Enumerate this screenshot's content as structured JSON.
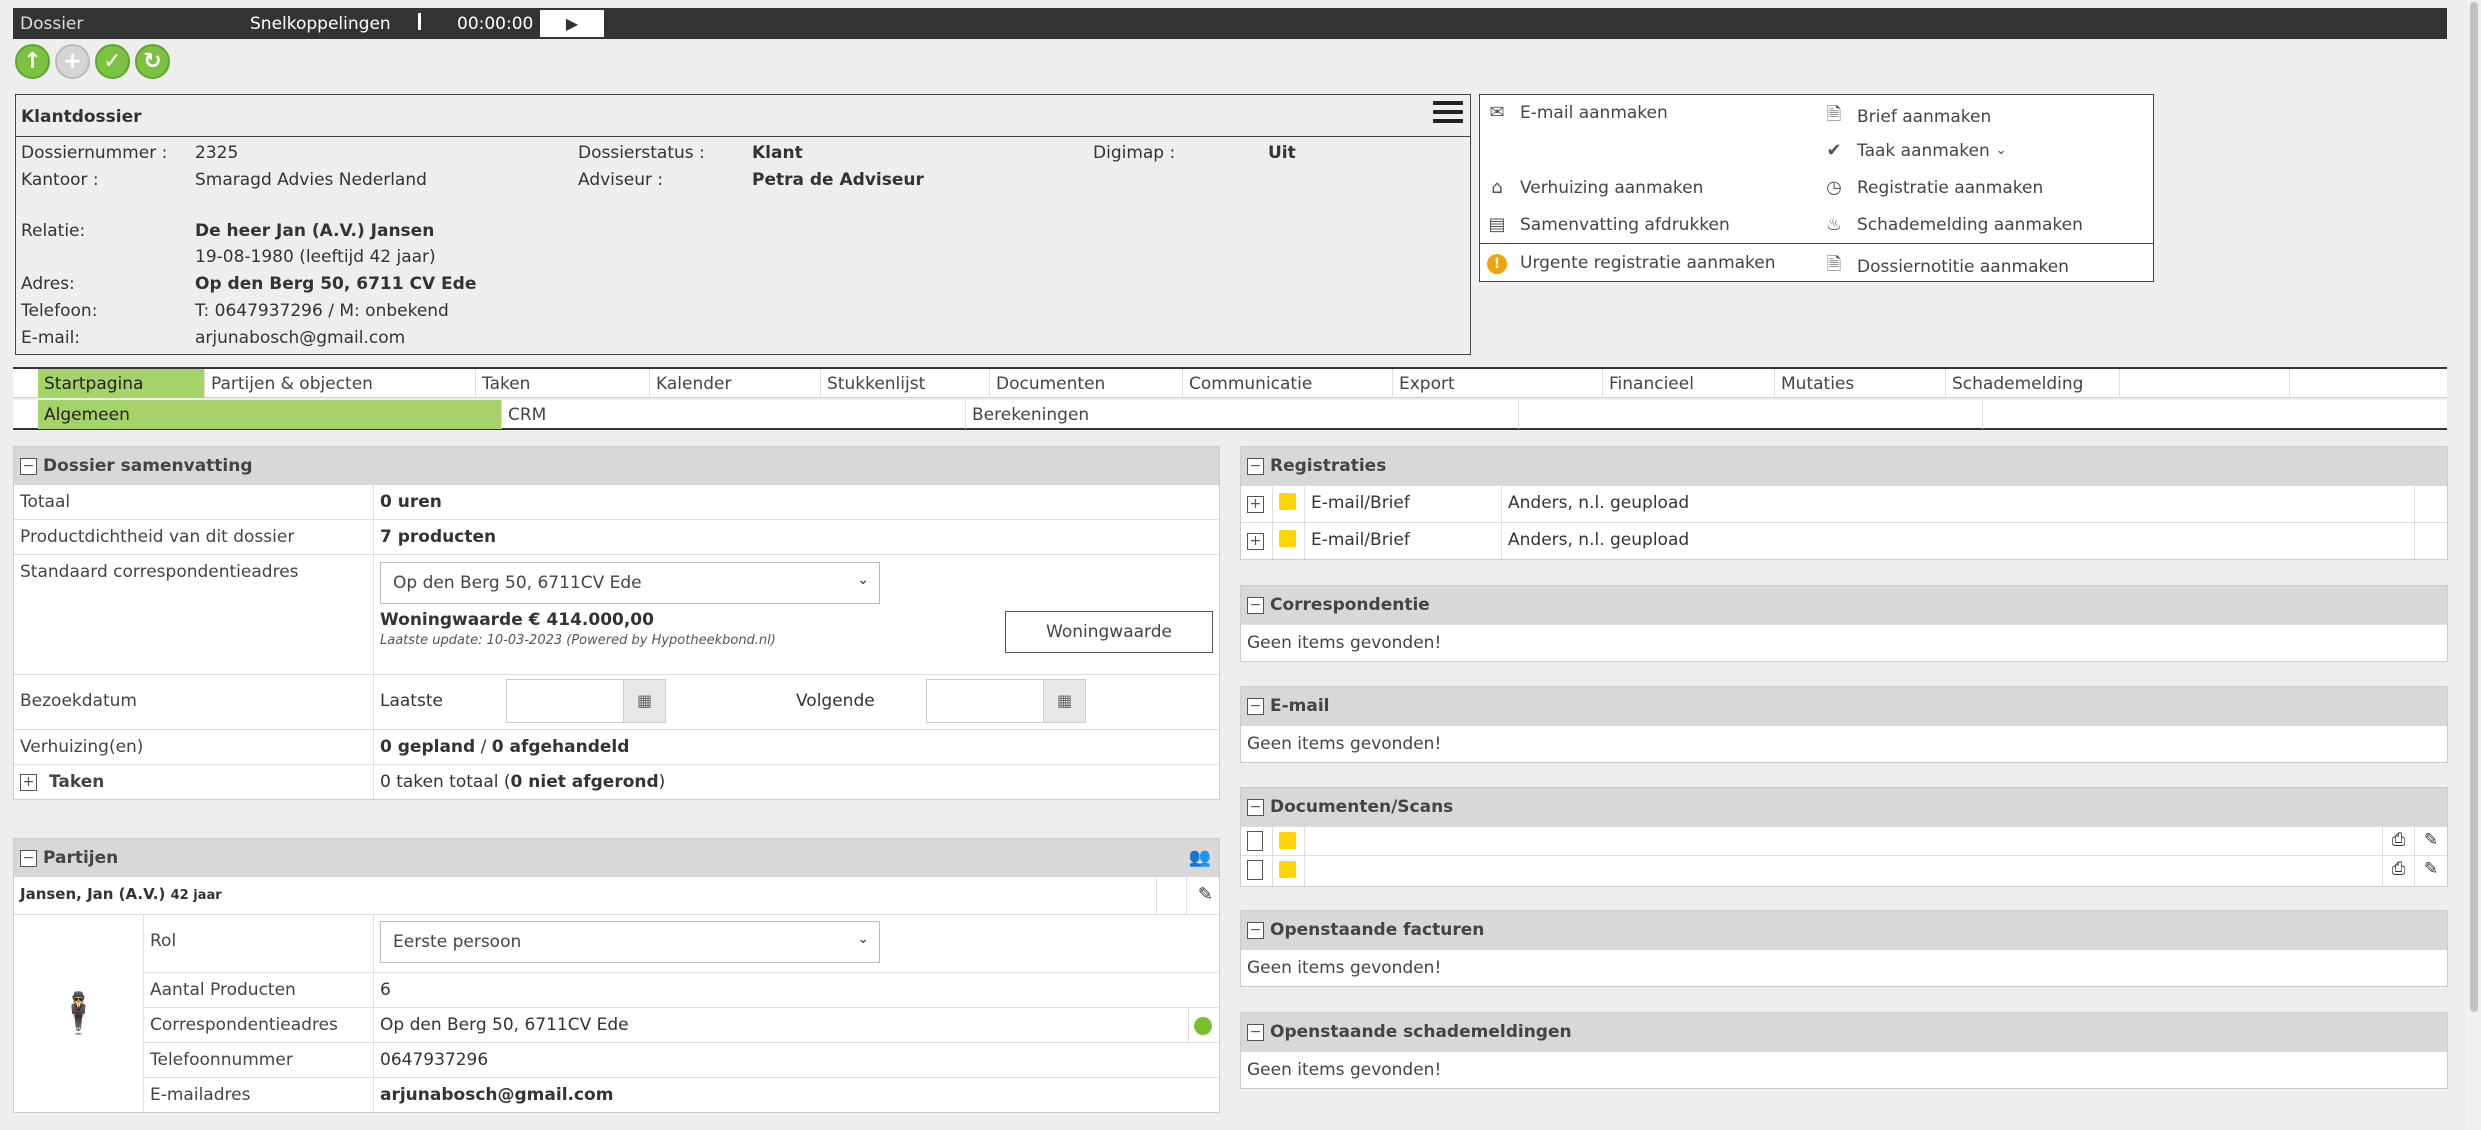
{
  "topbar": {
    "title": "Dossier",
    "shortcuts": "Snelkoppelingen",
    "timer": "00:00:00",
    "play": "▶"
  },
  "klant": {
    "title": "Klantdossier",
    "dossiernummer_label": "Dossiernummer :",
    "dossiernummer": "2325",
    "kantoor_label": "Kantoor :",
    "kantoor": "Smaragd Advies Nederland",
    "dossierstatus_label": "Dossierstatus :",
    "dossierstatus": "Klant",
    "adviseur_label": "Adviseur :",
    "adviseur": "Petra de Adviseur",
    "digimap_label": "Digimap :",
    "digimap": "Uit",
    "relatie_label": "Relatie:",
    "relatie": "De heer Jan (A.V.) Jansen",
    "geboorte": "19-08-1980 (leeftijd 42 jaar)",
    "adres_label": "Adres:",
    "adres": "Op den Berg 50, 6711 CV Ede",
    "telefoon_label": "Telefoon:",
    "telefoon_prefix": "T: ",
    "telefoon": "0647937296",
    "telefoon_suffix": " / M: onbekend",
    "email_label": "E-mail:",
    "email": "arjunabosch@gmail.com"
  },
  "actions": {
    "email": "E-mail aanmaken",
    "brief": "Brief aanmaken",
    "taak": "Taak aanmaken",
    "verhuizing": "Verhuizing aanmaken",
    "registratie": "Registratie aanmaken",
    "samenvatting": "Samenvatting afdrukken",
    "schademelding": "Schademelding aanmaken",
    "urgente": "Urgente registratie aanmaken",
    "dossiernotitie": "Dossiernotitie aanmaken"
  },
  "tabs": [
    "Startpagina",
    "Partijen & objecten",
    "Taken",
    "Kalender",
    "Stukkenlijst",
    "Documenten",
    "Communicatie",
    "Export",
    "Financieel",
    "Mutaties",
    "Schademelding"
  ],
  "subtabs": [
    "Algemeen",
    "CRM",
    "Berekeningen"
  ],
  "samenvatting": {
    "title": "Dossier samenvatting",
    "totaal_label": "Totaal",
    "totaal": "0 uren",
    "product_label": "Productdichtheid van dit dossier",
    "product": "7 producten",
    "corr_label": "Standaard correspondentieadres",
    "corr_select": "Op den Berg 50, 6711CV Ede",
    "woningwaarde": "Woningwaarde € 414.000,00",
    "laatste_update": "Laatste update: 10-03-2023 (Powered by Hypotheekbond.nl)",
    "woningwaarde_btn": "Woningwaarde",
    "bezoek_label": "Bezoekdatum",
    "laatste": "Laatste",
    "volgende": "Volgende",
    "verhuizing_label": "Verhuizing(en)",
    "gepland": "0 gepland",
    "slash": " / ",
    "afgehandeld": "0 afgehandeld",
    "taken_label": "Taken",
    "taken_prefix": "0 taken totaal (",
    "taken_bold": "0 niet afgerond",
    "taken_suffix": ")"
  },
  "partijen": {
    "title": "Partijen",
    "person": "Jansen, Jan (A.V.)",
    "age": "42 jaar",
    "rol_label": "Rol",
    "rol": "Eerste persoon",
    "aantal_label": "Aantal Producten",
    "aantal": "6",
    "corr_label": "Correspondentieadres",
    "corr": "Op den Berg 50, 6711CV Ede",
    "tel_label": "Telefoonnummer",
    "tel": "0647937296",
    "mail_label": "E-mailadres",
    "mail": "arjunabosch@gmail.com"
  },
  "registraties": {
    "title": "Registraties",
    "rows": [
      {
        "type": "E-mail/Brief",
        "desc": "Anders, n.l. geupload"
      },
      {
        "type": "E-mail/Brief",
        "desc": "Anders, n.l. geupload"
      }
    ]
  },
  "correspondentie": {
    "title": "Correspondentie",
    "empty": "Geen items gevonden!"
  },
  "email": {
    "title": "E-mail",
    "empty": "Geen items gevonden!"
  },
  "documenten": {
    "title": "Documenten/Scans"
  },
  "facturen": {
    "title": "Openstaande facturen",
    "empty": "Geen items gevonden!"
  },
  "schade": {
    "title": "Openstaande schademeldingen",
    "empty": "Geen items gevonden!"
  }
}
